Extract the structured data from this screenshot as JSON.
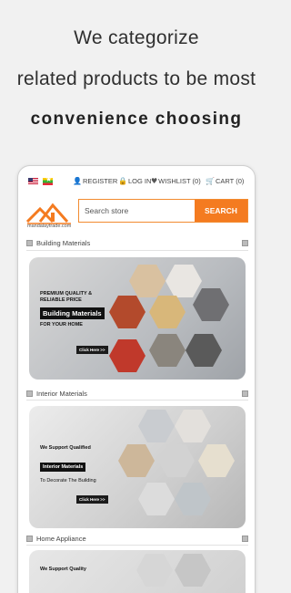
{
  "promo": {
    "line1": "We categorize",
    "line2": "related products to be most",
    "line3": "convenience choosing"
  },
  "nav": {
    "register": "REGISTER",
    "login": "LOG IN",
    "wishlist": "WISHLIST (0)",
    "cart": "CART (0)"
  },
  "logo": {
    "text": "mandalaytrade.com"
  },
  "search": {
    "placeholder": "Search store",
    "button": "SEARCH"
  },
  "sections": [
    {
      "title": "Building Materials",
      "banner": {
        "line1": "PREMIUM QUALITY &",
        "line2": "RELIABLE PRICE",
        "highlight": "Building Materials",
        "line3": "FOR YOUR HOME",
        "cta": "Click Here >>"
      }
    },
    {
      "title": "Interior Materials",
      "banner": {
        "line1": "We Support Qualified",
        "highlight": "Interior Materials",
        "line3": "To Decorate The Building",
        "cta": "Click Here >>"
      }
    },
    {
      "title": "Home Appliance",
      "banner": {
        "line1": "We Support Quality"
      }
    }
  ],
  "colors": {
    "accent": "#f47b20",
    "text": "#333333"
  }
}
